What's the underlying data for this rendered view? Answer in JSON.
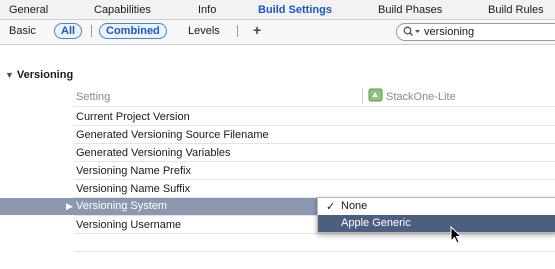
{
  "tabs": [
    {
      "label": "General",
      "selected": false
    },
    {
      "label": "Capabilities",
      "selected": false
    },
    {
      "label": "Info",
      "selected": false
    },
    {
      "label": "Build Settings",
      "selected": true
    },
    {
      "label": "Build Phases",
      "selected": false
    },
    {
      "label": "Build Rules",
      "selected": false
    }
  ],
  "filters": {
    "basic": "Basic",
    "all": "All",
    "combined": "Combined",
    "levels": "Levels",
    "add": "+"
  },
  "search": {
    "value": "versioning",
    "icon": "magnifier-dropdown-icon"
  },
  "section": {
    "title": "Versioning"
  },
  "columns": {
    "setting": "Setting",
    "target": "StackOne-Lite",
    "target_icon": "target-icon"
  },
  "rows": [
    {
      "label": "Current Project Version"
    },
    {
      "label": "Generated Versioning Source Filename"
    },
    {
      "label": "Generated Versioning Variables"
    },
    {
      "label": "Versioning Name Prefix"
    },
    {
      "label": "Versioning Name Suffix"
    },
    {
      "label": "Versioning System",
      "selected": true
    },
    {
      "label": "Versioning Username"
    }
  ],
  "menu": {
    "items": [
      {
        "label": "None",
        "checked": true
      },
      {
        "label": "Apple Generic",
        "highlighted": true
      }
    ],
    "check_symbol": "✓"
  },
  "colors": {
    "accent": "#1f57c4",
    "selected_row": "#8b98b0",
    "menu_highlight": "#4d5f80"
  }
}
